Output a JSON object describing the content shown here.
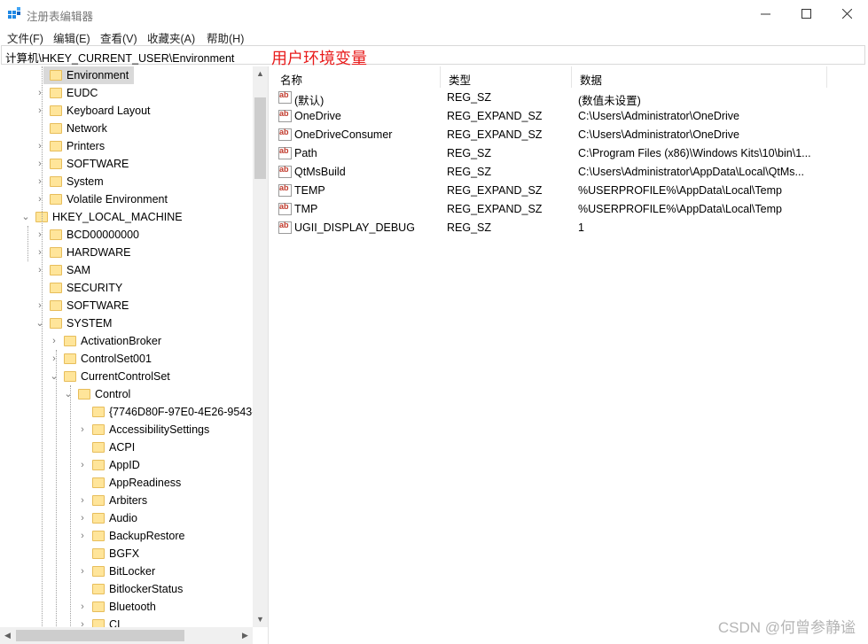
{
  "window": {
    "title": "注册表编辑器",
    "minimize_icon": "minimize-icon",
    "maximize_icon": "maximize-icon",
    "close_icon": "close-icon"
  },
  "menu": [
    "文件(F)",
    "编辑(E)",
    "查看(V)",
    "收藏夹(A)",
    "帮助(H)"
  ],
  "address": {
    "path": "计算机\\HKEY_CURRENT_USER\\Environment",
    "annotation": "用户环境变量"
  },
  "tree": [
    {
      "label": "Environment",
      "level": 0,
      "arrow": "",
      "selected": true
    },
    {
      "label": "EUDC",
      "level": 0,
      "arrow": "›"
    },
    {
      "label": "Keyboard Layout",
      "level": 0,
      "arrow": "›"
    },
    {
      "label": "Network",
      "level": 0,
      "arrow": ""
    },
    {
      "label": "Printers",
      "level": 0,
      "arrow": "›"
    },
    {
      "label": "SOFTWARE",
      "level": 0,
      "arrow": "›"
    },
    {
      "label": "System",
      "level": 0,
      "arrow": "›"
    },
    {
      "label": "Volatile Environment",
      "level": 0,
      "arrow": "›"
    },
    {
      "label": "HKEY_LOCAL_MACHINE",
      "level": -1,
      "arrow": "⌄"
    },
    {
      "label": "BCD00000000",
      "level": 0,
      "arrow": "›"
    },
    {
      "label": "HARDWARE",
      "level": 0,
      "arrow": "›"
    },
    {
      "label": "SAM",
      "level": 0,
      "arrow": "›"
    },
    {
      "label": "SECURITY",
      "level": 0,
      "arrow": ""
    },
    {
      "label": "SOFTWARE",
      "level": 0,
      "arrow": "›"
    },
    {
      "label": "SYSTEM",
      "level": 0,
      "arrow": "⌄"
    },
    {
      "label": "ActivationBroker",
      "level": 1,
      "arrow": "›"
    },
    {
      "label": "ControlSet001",
      "level": 1,
      "arrow": "›"
    },
    {
      "label": "CurrentControlSet",
      "level": 1,
      "arrow": "⌄"
    },
    {
      "label": "Control",
      "level": 2,
      "arrow": "⌄"
    },
    {
      "label": "{7746D80F-97E0-4E26-9543-",
      "level": 3,
      "arrow": ""
    },
    {
      "label": "AccessibilitySettings",
      "level": 3,
      "arrow": "›"
    },
    {
      "label": "ACPI",
      "level": 3,
      "arrow": ""
    },
    {
      "label": "AppID",
      "level": 3,
      "arrow": "›"
    },
    {
      "label": "AppReadiness",
      "level": 3,
      "arrow": ""
    },
    {
      "label": "Arbiters",
      "level": 3,
      "arrow": "›"
    },
    {
      "label": "Audio",
      "level": 3,
      "arrow": "›"
    },
    {
      "label": "BackupRestore",
      "level": 3,
      "arrow": "›"
    },
    {
      "label": "BGFX",
      "level": 3,
      "arrow": ""
    },
    {
      "label": "BitLocker",
      "level": 3,
      "arrow": "›"
    },
    {
      "label": "BitlockerStatus",
      "level": 3,
      "arrow": ""
    },
    {
      "label": "Bluetooth",
      "level": 3,
      "arrow": "›"
    },
    {
      "label": "CI",
      "level": 3,
      "arrow": "›"
    }
  ],
  "columns": [
    "名称",
    "类型",
    "数据"
  ],
  "values": [
    {
      "name": "(默认)",
      "type": "REG_SZ",
      "data": "(数值未设置)"
    },
    {
      "name": "OneDrive",
      "type": "REG_EXPAND_SZ",
      "data": "C:\\Users\\Administrator\\OneDrive"
    },
    {
      "name": "OneDriveConsumer",
      "type": "REG_EXPAND_SZ",
      "data": "C:\\Users\\Administrator\\OneDrive"
    },
    {
      "name": "Path",
      "type": "REG_SZ",
      "data": "C:\\Program Files (x86)\\Windows Kits\\10\\bin\\1..."
    },
    {
      "name": "QtMsBuild",
      "type": "REG_SZ",
      "data": "C:\\Users\\Administrator\\AppData\\Local\\QtMs..."
    },
    {
      "name": "TEMP",
      "type": "REG_EXPAND_SZ",
      "data": "%USERPROFILE%\\AppData\\Local\\Temp"
    },
    {
      "name": "TMP",
      "type": "REG_EXPAND_SZ",
      "data": "%USERPROFILE%\\AppData\\Local\\Temp"
    },
    {
      "name": "UGII_DISPLAY_DEBUG",
      "type": "REG_SZ",
      "data": "1"
    }
  ],
  "value_icon": "ab",
  "watermark": "CSDN @何曾参静谧"
}
